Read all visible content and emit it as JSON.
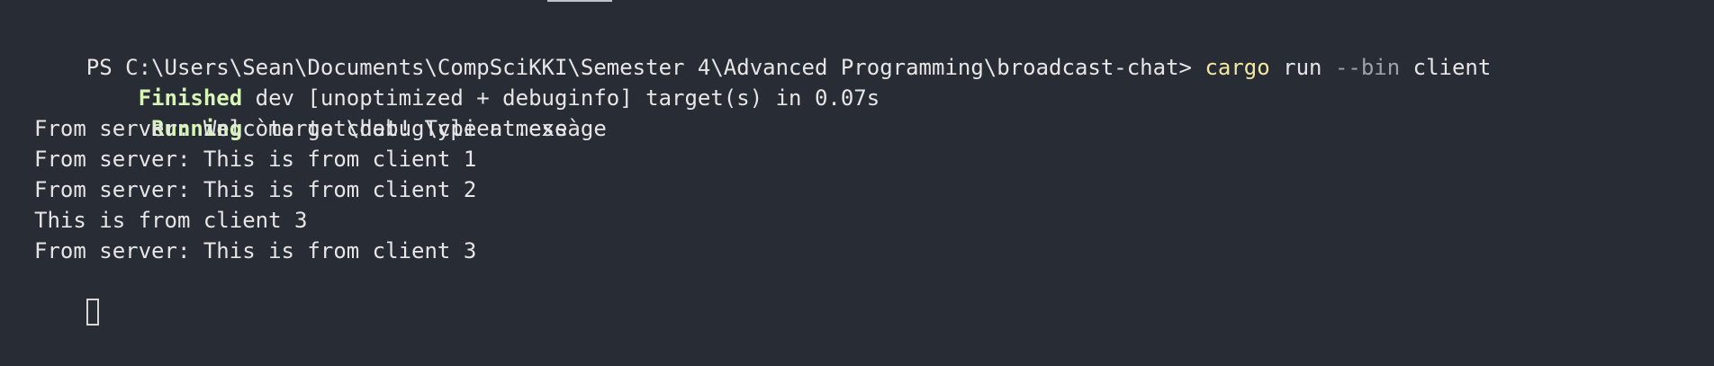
{
  "terminal": {
    "prompt_path": "PS C:\\Users\\Sean\\Documents\\CompSciKKI\\Semester 4\\Advanced Programming\\broadcast-chat> ",
    "command_cargo": "cargo",
    "command_run": " run ",
    "command_flag": "--bin",
    "command_target": " client",
    "finished_label": "    Finished",
    "finished_text": " dev [unoptimized + debuginfo] target(s) in 0.07s",
    "running_label": "     Running",
    "running_text": " `target\\debug\\client.exe`",
    "output_lines": [
      "From server: Welcome to chat! Type a message",
      "From server: This is from client 1",
      "From server: This is from client 2",
      "This is from client 3",
      "From server: This is from client 3"
    ]
  },
  "colors": {
    "background": "#282c34",
    "text": "#e6e6e6",
    "accent_green": "#d8f5b8",
    "command_yellow": "#f3e7a2",
    "muted_gray": "#9da3ad"
  }
}
